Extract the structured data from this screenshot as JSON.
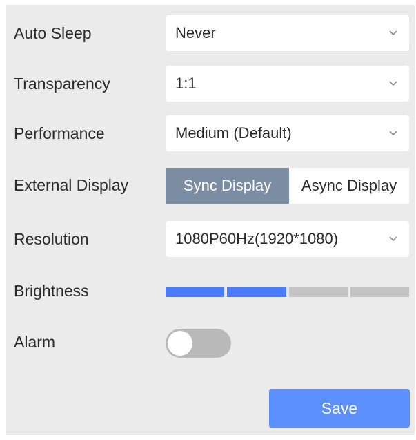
{
  "settings": {
    "auto_sleep": {
      "label": "Auto Sleep",
      "value": "Never"
    },
    "transparency": {
      "label": "Transparency",
      "value": "1:1"
    },
    "performance": {
      "label": "Performance",
      "value": "Medium (Default)"
    },
    "external_display": {
      "label": "External Display",
      "options": [
        "Sync Display",
        "Async Display"
      ],
      "selected": "Sync Display"
    },
    "resolution": {
      "label": "Resolution",
      "value": "1080P60Hz(1920*1080)"
    },
    "brightness": {
      "label": "Brightness",
      "level": 2,
      "max": 4
    },
    "alarm": {
      "label": "Alarm",
      "enabled": false
    }
  },
  "actions": {
    "save_label": "Save"
  },
  "colors": {
    "panel_bg": "#ebebeb",
    "accent": "#5c8fff",
    "brightness_on": "#4a7bff",
    "brightness_off": "#c4c4c4",
    "segment_active": "#7b8ca3",
    "toggle_off": "#b9b9b9"
  },
  "icons": {
    "dropdown": "chevron-down-icon"
  }
}
